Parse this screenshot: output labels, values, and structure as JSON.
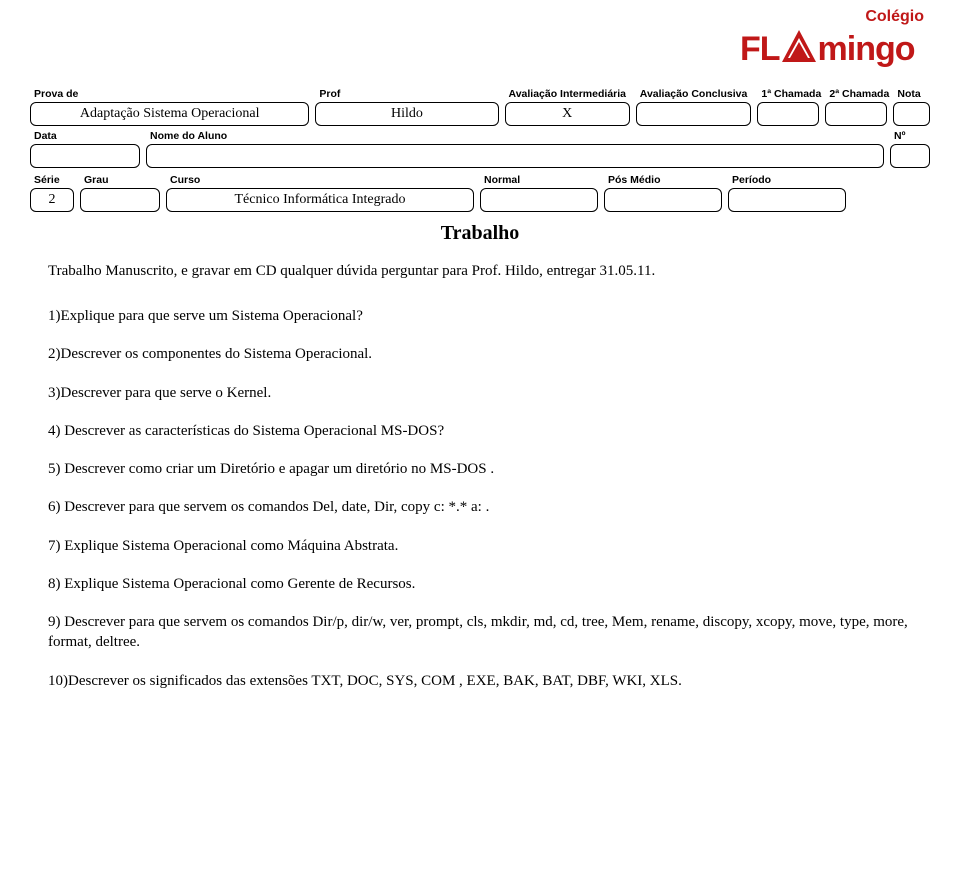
{
  "logo": {
    "top_label": "Colégio",
    "brand_left": "FL",
    "brand_right": "mingo",
    "brand_color": "#c01818"
  },
  "header": {
    "prova_label": "Prova de",
    "prova_value": "Adaptação Sistema Operacional",
    "prof_label": "Prof",
    "prof_value": "Hildo",
    "aval_int_label": "Avaliação Intermediária",
    "aval_int_value": "X",
    "aval_conc_label": "Avaliação Conclusiva",
    "aval_conc_value": "",
    "cham1_label": "1ª Chamada",
    "cham1_value": "",
    "cham2_label": "2ª Chamada",
    "cham2_value": "",
    "nota_label": "Nota",
    "nota_value": "",
    "data_label": "Data",
    "data_value": "",
    "nome_label": "Nome do Aluno",
    "nome_value": "",
    "num_label": "Nº",
    "num_value": "",
    "serie_label": "Série",
    "serie_value": "2",
    "grau_label": "Grau",
    "grau_value": "",
    "curso_label": "Curso",
    "curso_value": "Técnico Informática Integrado",
    "normal_label": "Normal",
    "normal_value": "",
    "posmedio_label": "Pós Médio",
    "posmedio_value": "",
    "periodo_label": "Período",
    "periodo_value": ""
  },
  "title": "Trabalho",
  "instruction": "Trabalho Manuscrito,  e gravar em CD qualquer dúvida perguntar para Prof. Hildo, entregar  31.05.11.",
  "questions": {
    "q1": "1)Explique  para que serve um Sistema Operacional?",
    "q2": "2)Descrever os componentes do Sistema Operacional.",
    "q3": "3)Descrever para que serve o Kernel.",
    "q4": "4) Descrever as características do Sistema Operacional MS-DOS?",
    "q5": "5) Descrever como criar um Diretório e apagar um diretório no MS-DOS .",
    "q6": "6) Descrever para que servem os comandos Del, date, Dir, copy c: *.* a: .",
    "q7": "7) Explique Sistema Operacional como Máquina Abstrata.",
    "q8": "8) Explique Sistema Operacional como Gerente de Recursos.",
    "q9": "9) Descrever  para que servem os comandos Dir/p, dir/w, ver, prompt, cls, mkdir, md, cd, tree, Mem, rename, discopy, xcopy, move, type, more, format, deltree.",
    "q10": "10)Descrever os significados das extensões TXT, DOC, SYS, COM , EXE, BAK, BAT, DBF, WKI, XLS."
  }
}
